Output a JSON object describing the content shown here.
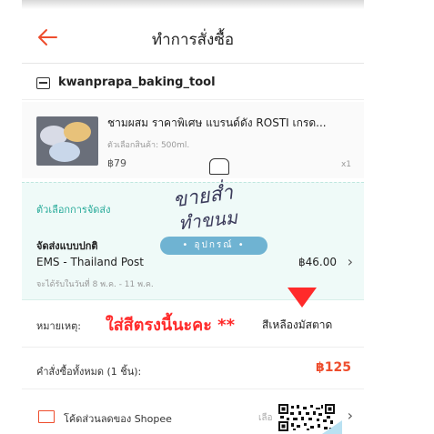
{
  "header": {
    "title": "ทำการสั่งซื้อ",
    "back_icon": "arrow-left-icon"
  },
  "shop": {
    "name": "kwanprapa_baking_tool",
    "icon": "store-icon"
  },
  "product": {
    "name": "ชามผสม ราคาพิเศษ แบรนด์ดัง ROSTI เกรด...",
    "variant": "ตัวเลือกสินค้า: 500ml.",
    "price": "฿79",
    "qty": "x1"
  },
  "shipping": {
    "header": "ตัวเลือกการจัดส่ง",
    "method": "จัดส่งแบบปกติ",
    "carrier": "EMS - Thailand Post",
    "price": "฿46.00",
    "eta": "จะได้รับในวันที่ 8 พ.ค. - 11 พ.ค."
  },
  "note": {
    "label": "หมายเหตุ:",
    "annotation": "ใส่สีตรงนี้นะคะ **",
    "value": "สีเหลืองมัสตาด"
  },
  "total": {
    "label": "คำสั่งซื้อทั้งหมด (1 ชิ้น):",
    "price": "฿125"
  },
  "voucher": {
    "label": "โค้ดส่วนลดของ Shopee",
    "select": "เลือ",
    "icon": "voucher-icon"
  },
  "watermark": {
    "line1": "ขายส่ำ",
    "line2": "ทำขนม",
    "pill": "• อุปกรณ์ •"
  },
  "colors": {
    "brand": "#ee4d2d",
    "teal": "#26aa99",
    "annotation_red": "#ff2a2a"
  }
}
